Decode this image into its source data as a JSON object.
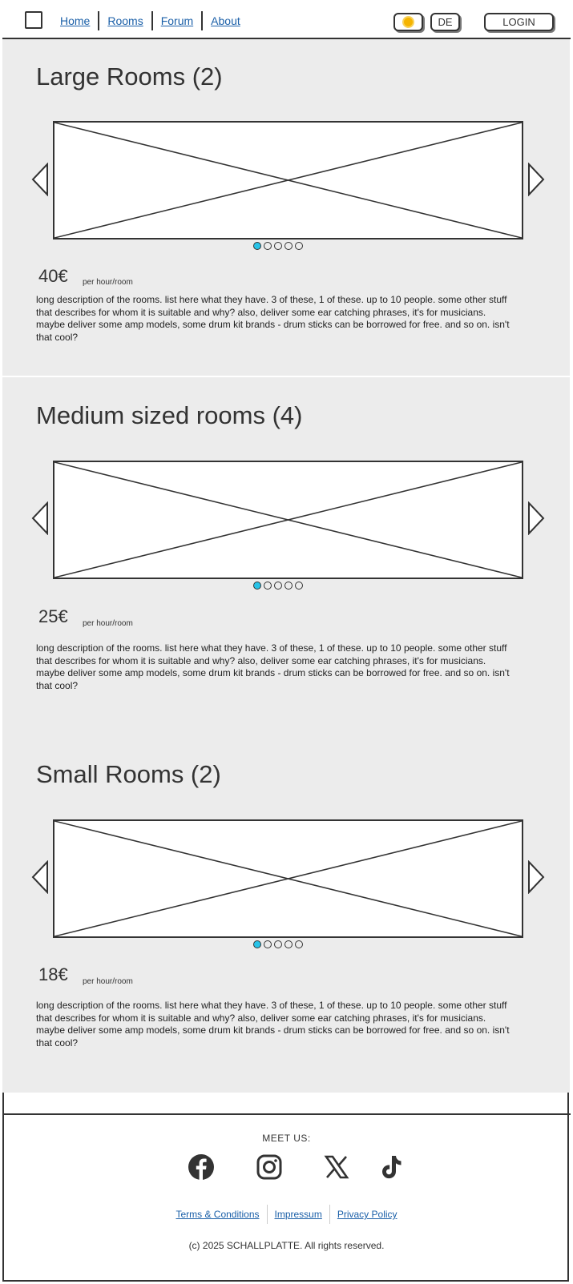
{
  "header": {
    "menu_icon": "hamburger-menu-icon",
    "nav": [
      "Home",
      "Rooms",
      "Forum",
      "About"
    ],
    "theme_icon": "sun-icon",
    "language": "DE",
    "login": "LOGIN"
  },
  "sections": [
    {
      "title": "Large Rooms (2)",
      "price": "40€",
      "unit": "per hour/room",
      "description": "long description of the rooms. list here what they have. 3 of these, 1 of these. up to 10 people. some other stuff that describes for whom it is suitable and why? also, deliver some ear catching phrases, it's for musicians. maybe deliver some amp models, some drum kit brands - drum sticks can be borrowed for free. and so on. isn't that cool?",
      "slides": 5,
      "active_slide": 1
    },
    {
      "title": "Medium sized rooms (4)",
      "price": "25€",
      "unit": "per hour/room",
      "description": "long description of the rooms. list here what they have. 3 of these, 1 of these. up to 10 people. some other stuff that describes for whom it is suitable and why? also, deliver some ear catching phrases, it's for musicians. maybe deliver some amp models, some drum kit brands - drum sticks can be borrowed for free. and so on. isn't that cool?",
      "slides": 5,
      "active_slide": 1
    },
    {
      "title": "Small Rooms (2)",
      "price": "18€",
      "unit": "per hour/room",
      "description": "long description of the rooms. list here what they have. 3 of these, 1 of these. up to 10 people. some other stuff that describes for whom it is suitable and why? also, deliver some ear catching phrases, it's for musicians. maybe deliver some amp models, some drum kit brands - drum sticks can be borrowed for free. and so on. isn't that cool?",
      "slides": 5,
      "active_slide": 1
    }
  ],
  "footer": {
    "meet_us": "MEET US:",
    "social_icons": [
      "facebook-icon",
      "instagram-icon",
      "x-icon",
      "tiktok-icon"
    ],
    "links": [
      "Terms & Conditions",
      "Impressum",
      "Privacy Policy"
    ],
    "copyright": "(c) 2025 SCHALLPLATTE. All rights reserved."
  },
  "colors": {
    "link": "#1a5fa8",
    "active_dot": "#27c3e8",
    "section_bg": "#ececec",
    "sun": "#f5b400"
  }
}
